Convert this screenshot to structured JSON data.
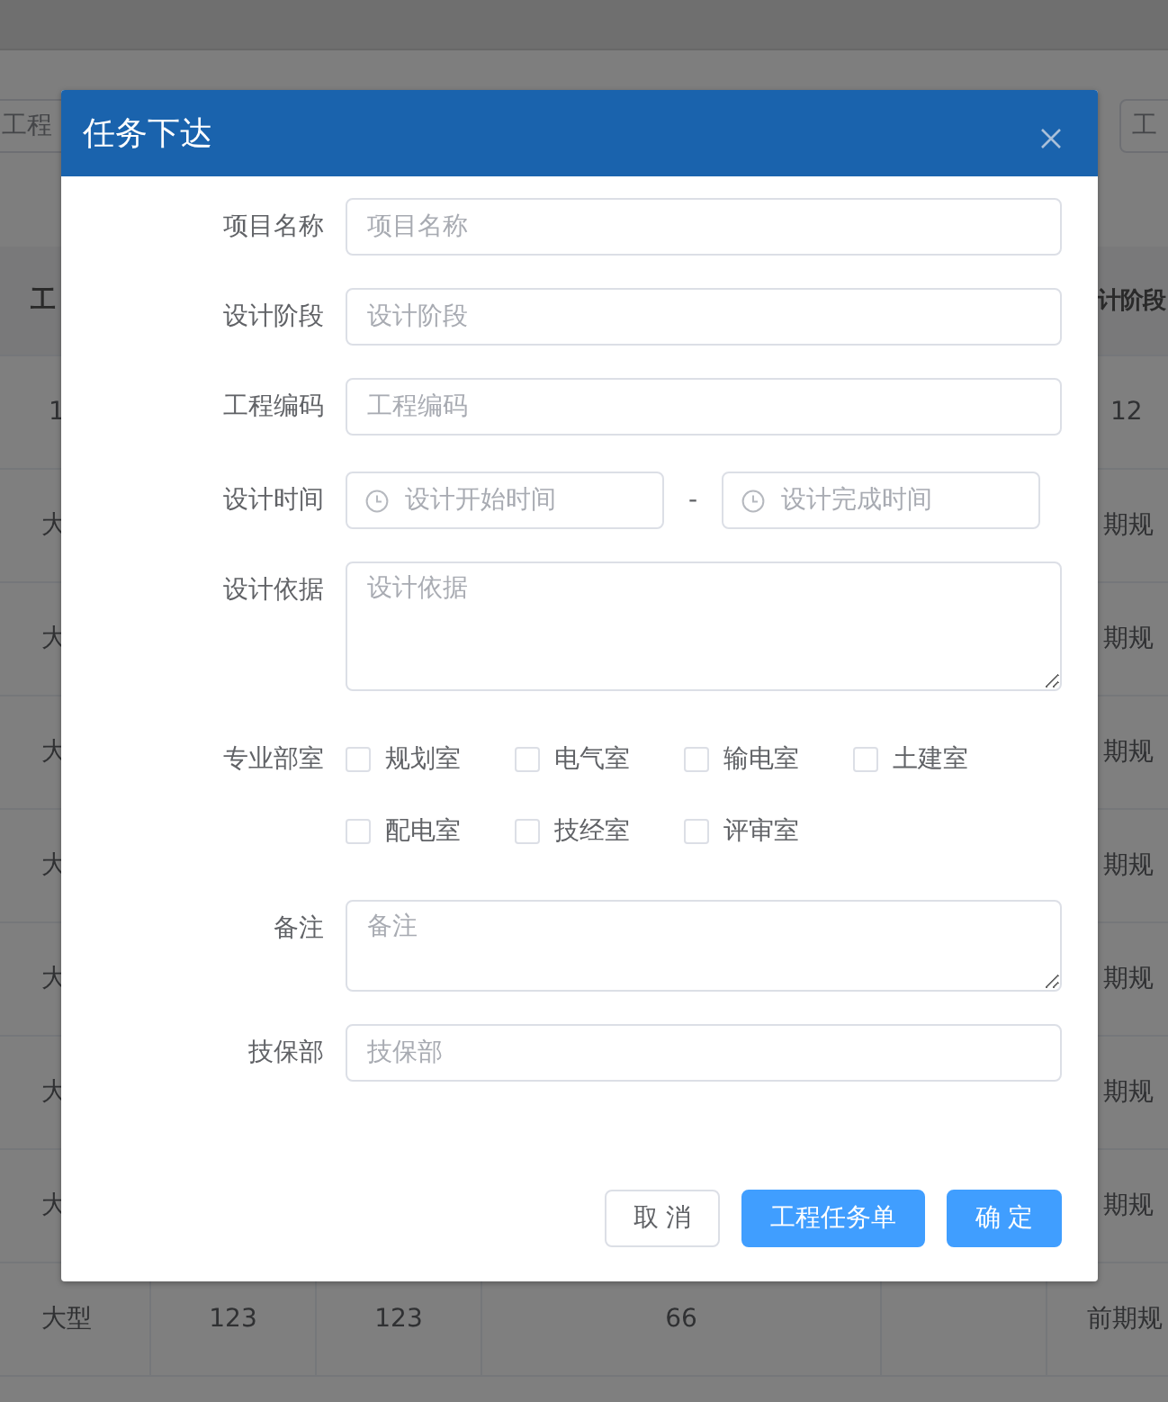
{
  "background": {
    "filters": [
      {
        "placeholder": "工程"
      },
      {
        "placeholder": "工"
      }
    ],
    "table": {
      "header": {
        "column_1": "工",
        "column_6": "计阶段"
      },
      "rows": [
        {
          "column_1": "1",
          "column_6": "12"
        },
        {
          "column_1": "大",
          "column_6": "期规"
        },
        {
          "column_1": "大",
          "column_6": "期规"
        },
        {
          "column_1": "大",
          "column_6": "期规"
        },
        {
          "column_1": "大",
          "column_6": "期规"
        },
        {
          "column_1": "大",
          "column_6": "期规"
        },
        {
          "column_1": "大",
          "column_6": "期规"
        },
        {
          "column_1": "大",
          "column_6": "期规"
        },
        {
          "column_1": "大型",
          "column_2": "123",
          "column_3": "123",
          "column_4": "66",
          "column_6": "前期规"
        }
      ]
    }
  },
  "dialog": {
    "title": "任务下达",
    "fields": [
      {
        "kind": "text",
        "label": "项目名称",
        "placeholder": "项目名称"
      },
      {
        "kind": "text",
        "label": "设计阶段",
        "placeholder": "设计阶段"
      },
      {
        "kind": "text",
        "label": "工程编码",
        "placeholder": "工程编码"
      },
      {
        "kind": "date-range",
        "label": "设计时间",
        "start_placeholder": "设计开始时间",
        "separator": "-",
        "end_placeholder": "设计完成时间"
      },
      {
        "kind": "textarea",
        "label": "设计依据",
        "placeholder": "设计依据"
      },
      {
        "kind": "checkboxes",
        "label": "专业部室",
        "options": [
          {
            "label": "规划室",
            "checked": false
          },
          {
            "label": "电气室",
            "checked": false
          },
          {
            "label": "输电室",
            "checked": false
          },
          {
            "label": "土建室",
            "checked": false
          },
          {
            "label": "配电室",
            "checked": false
          },
          {
            "label": "技经室",
            "checked": false
          },
          {
            "label": "评审室",
            "checked": false
          }
        ]
      },
      {
        "kind": "textarea-small",
        "label": "备注",
        "placeholder": "备注"
      },
      {
        "kind": "text",
        "label": "技保部",
        "placeholder": "技保部"
      }
    ],
    "buttons": [
      {
        "label": "取 消",
        "kind": "default"
      },
      {
        "label": "工程任务单",
        "kind": "primary"
      },
      {
        "label": "确 定",
        "kind": "primary"
      }
    ]
  }
}
